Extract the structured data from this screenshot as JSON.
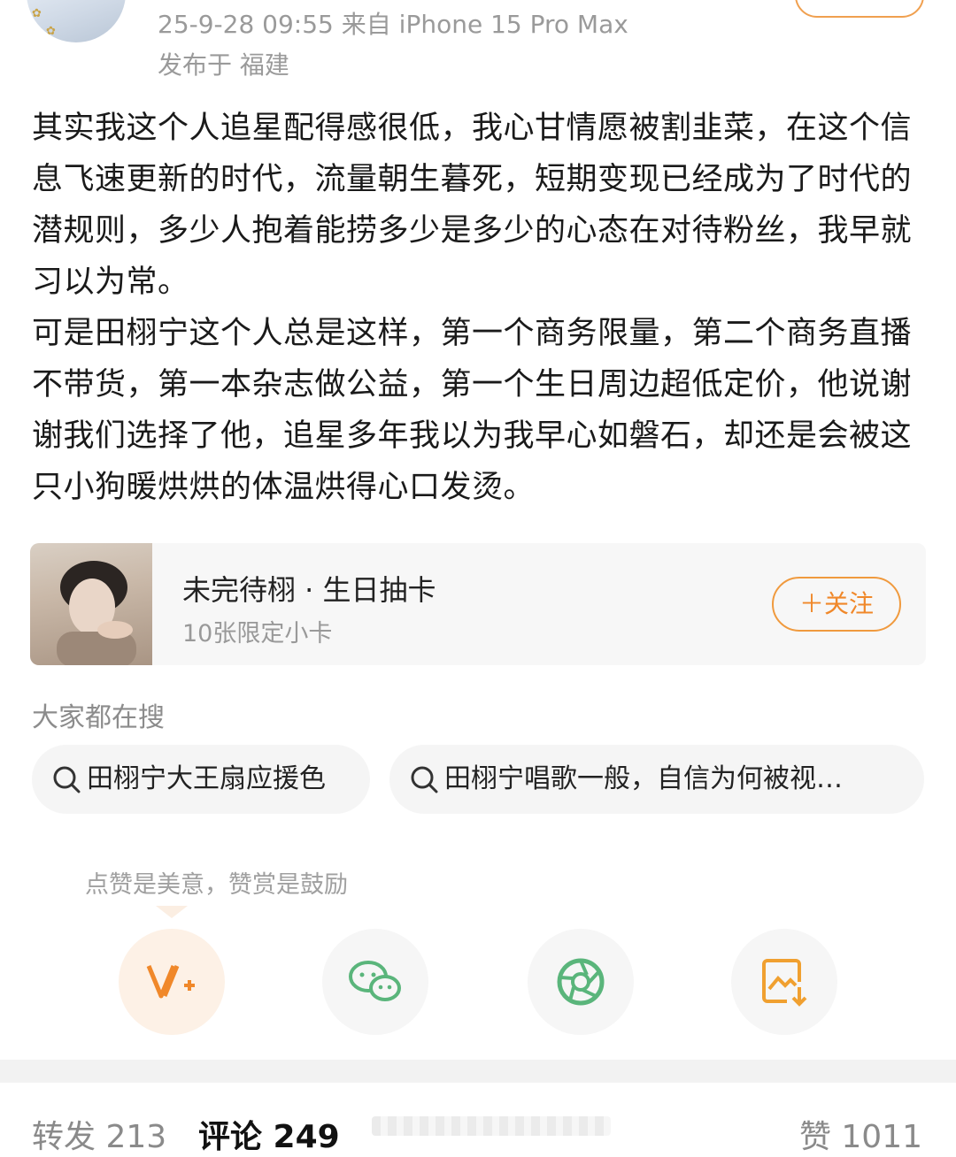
{
  "header": {
    "time_device": "25-9-28 09:55  来自 iPhone 15 Pro Max",
    "location": "发布于 福建"
  },
  "post": {
    "paragraph1": "其实我这个人追星配得感很低，我心甘情愿被割韭菜，在这个信息飞速更新的时代，流量朝生暮死，短期变现已经成为了时代的潜规则，多少人抱着能捞多少是多少的心态在对待粉丝，我早就习以为常。",
    "paragraph2": "可是田栩宁这个人总是这样，第一个商务限量，第二个商务直播不带货，第一本杂志做公益，第一个生日周边超低定价，他说谢谢我们选择了他，追星多年我以为我早心如磐石，却还是会被这只小狗暖烘烘的体温烘得心口发烫。"
  },
  "card": {
    "title": "未完待栩 · 生日抽卡",
    "subtitle": "10张限定小卡",
    "follow_label": "＋关注"
  },
  "search": {
    "heading": "大家都在搜",
    "items": [
      {
        "label": "田栩宁大王扇应援色",
        "icon": "search-icon"
      },
      {
        "label": "田栩宁唱歌一般，自信为何被视…",
        "icon": "search-icon"
      }
    ]
  },
  "reward": {
    "hint": "点赞是美意，赞赏是鼓励"
  },
  "share_actions": [
    {
      "icon": "reward-v-plus-icon",
      "color": "#f0882a"
    },
    {
      "icon": "wechat-icon",
      "color": "#5ab57b"
    },
    {
      "icon": "moments-shutter-icon",
      "color": "#5ab57b"
    },
    {
      "icon": "save-image-icon",
      "color": "#f0a030"
    }
  ],
  "tabs": {
    "repost": "转发 213",
    "comment": "评论 249",
    "like": "赞 1011"
  },
  "colors": {
    "accent": "#f0882a",
    "green": "#5ab57b",
    "muted": "#9a9a9a"
  }
}
